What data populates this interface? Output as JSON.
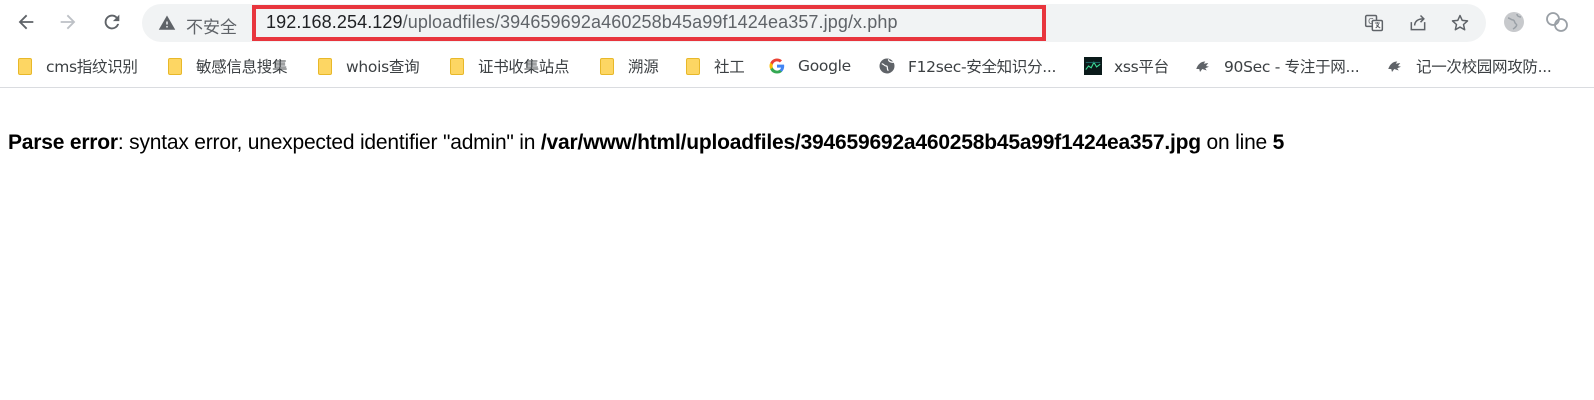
{
  "browser": {
    "security_label": "不安全",
    "url_host": "192.168.254.129",
    "url_path": "/uploadfiles/394659692a460258b45a99f1424ea357.jpg/x.php"
  },
  "bookmarks": [
    {
      "label": "cms指纹识别",
      "icon": "folder-icon"
    },
    {
      "label": "敏感信息搜集",
      "icon": "folder-icon"
    },
    {
      "label": "whois查询",
      "icon": "folder-icon"
    },
    {
      "label": "证书收集站点",
      "icon": "folder-icon"
    },
    {
      "label": "溯源",
      "icon": "folder-icon"
    },
    {
      "label": "社工",
      "icon": "folder-icon"
    },
    {
      "label": "Google",
      "icon": "google-icon"
    },
    {
      "label": "F12sec-安全知识分...",
      "icon": "globe-icon"
    },
    {
      "label": "xss平台",
      "icon": "xss-site-icon"
    },
    {
      "label": "90Sec - 专注于网...",
      "icon": "90sec-logo-icon"
    },
    {
      "label": "记一次校园网攻防...",
      "icon": "90sec-logo-icon"
    }
  ],
  "error": {
    "label": "Parse error",
    "message": ": syntax error, unexpected identifier \"admin\" in ",
    "file": "/var/www/html/uploadfiles/394659692a460258b45a99f1424ea357.jpg",
    "on_line": " on line ",
    "line": "5"
  },
  "colors": {
    "highlight_box": "#e8353d",
    "omnibox_bg": "#f1f3f4",
    "folder": "#fdd663"
  }
}
